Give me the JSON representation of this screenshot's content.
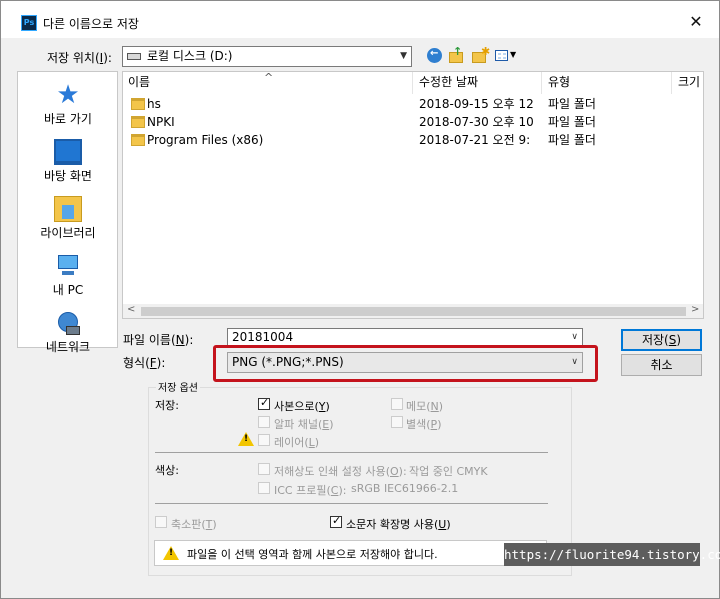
{
  "window": {
    "app_icon_text": "Ps",
    "title": "다른 이름으로 저장",
    "close_glyph": "✕"
  },
  "location": {
    "label": "저장 위치(I):",
    "value": "로컬 디스크 (D:)"
  },
  "places": [
    {
      "label": "바로 가기",
      "icon": "star-icon"
    },
    {
      "label": "바탕 화면",
      "icon": "desktop-icon"
    },
    {
      "label": "라이브러리",
      "icon": "library-icon"
    },
    {
      "label": "내 PC",
      "icon": "computer-icon"
    },
    {
      "label": "네트워크",
      "icon": "network-icon"
    }
  ],
  "file_list": {
    "columns": [
      "이름",
      "수정한 날짜",
      "유형",
      "크기"
    ],
    "rows": [
      {
        "name": "hs",
        "date": "2018-09-15 오후 12",
        "type": "파일 폴더"
      },
      {
        "name": "NPKI",
        "date": "2018-07-30 오후 10",
        "type": "파일 폴더"
      },
      {
        "name": "Program Files (x86)",
        "date": "2018-07-21 오전 9:",
        "type": "파일 폴더"
      }
    ]
  },
  "filename": {
    "label": "파일 이름(N):",
    "value": "20181004"
  },
  "format": {
    "label": "형식(F):",
    "value": "PNG (*.PNG;*.PNS)"
  },
  "buttons": {
    "save": "저장(S)",
    "cancel": "취소"
  },
  "save_options": {
    "title": "저장 옵션",
    "save_label": "저장:",
    "as_copy": {
      "label": "사본으로(Y)",
      "checked": true
    },
    "notes": {
      "label": "메모(N)",
      "checked": false
    },
    "alpha": {
      "label": "알파 채널(E)",
      "checked": false
    },
    "spot": {
      "label": "별색(P)",
      "checked": false
    },
    "layers": {
      "label": "레이어(L)",
      "checked": false
    }
  },
  "color_options": {
    "label": "색상:",
    "proof": {
      "label": "저해상도 인쇄 설정 사용(O):",
      "value": "작업 중인 CMYK",
      "checked": false
    },
    "icc": {
      "label": "ICC 프로필(C):",
      "value": "sRGB IEC61966-2.1",
      "checked": false
    }
  },
  "thumbnail": {
    "label": "축소판(T)",
    "checked": false
  },
  "lowercase_ext": {
    "label": "소문자 확장명 사용(U)",
    "checked": true
  },
  "warning_note": "파일을 이 선택 영역과 함께 사본으로 저장해야 합니다.",
  "watermark": "https://fluorite94.tistory.com"
}
